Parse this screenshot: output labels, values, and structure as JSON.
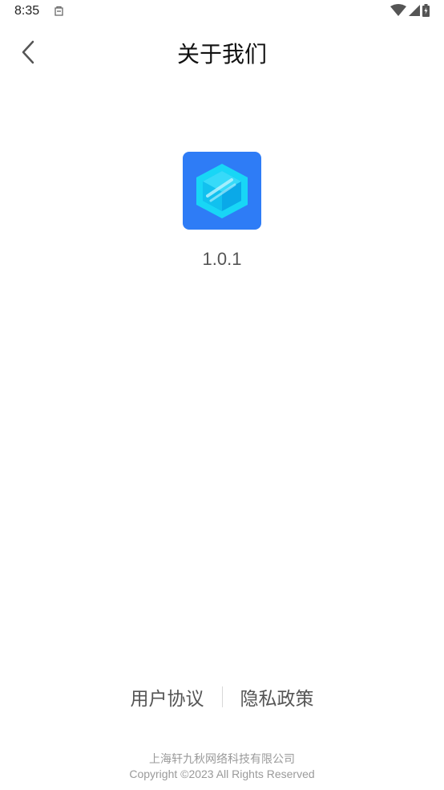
{
  "status_bar": {
    "time": "8:35",
    "icons": [
      "notification-icon",
      "wifi-icon",
      "signal-icon",
      "battery-icon"
    ]
  },
  "header": {
    "title": "关于我们",
    "back_icon": "chevron-left-icon"
  },
  "app": {
    "logo_icon": "hexagon-cube-logo",
    "version": "1.0.1"
  },
  "links": {
    "user_agreement": "用户协议",
    "privacy_policy": "隐私政策"
  },
  "footer": {
    "company": "上海轩九秋网络科技有限公司",
    "copyright": "Copyright ©2023 All Rights Reserved"
  },
  "colors": {
    "logo_background": "#2e7cf6",
    "logo_cyan": "#18d6f6",
    "text_primary": "#111111",
    "text_secondary": "#555555",
    "text_muted": "#9a9a9a"
  }
}
